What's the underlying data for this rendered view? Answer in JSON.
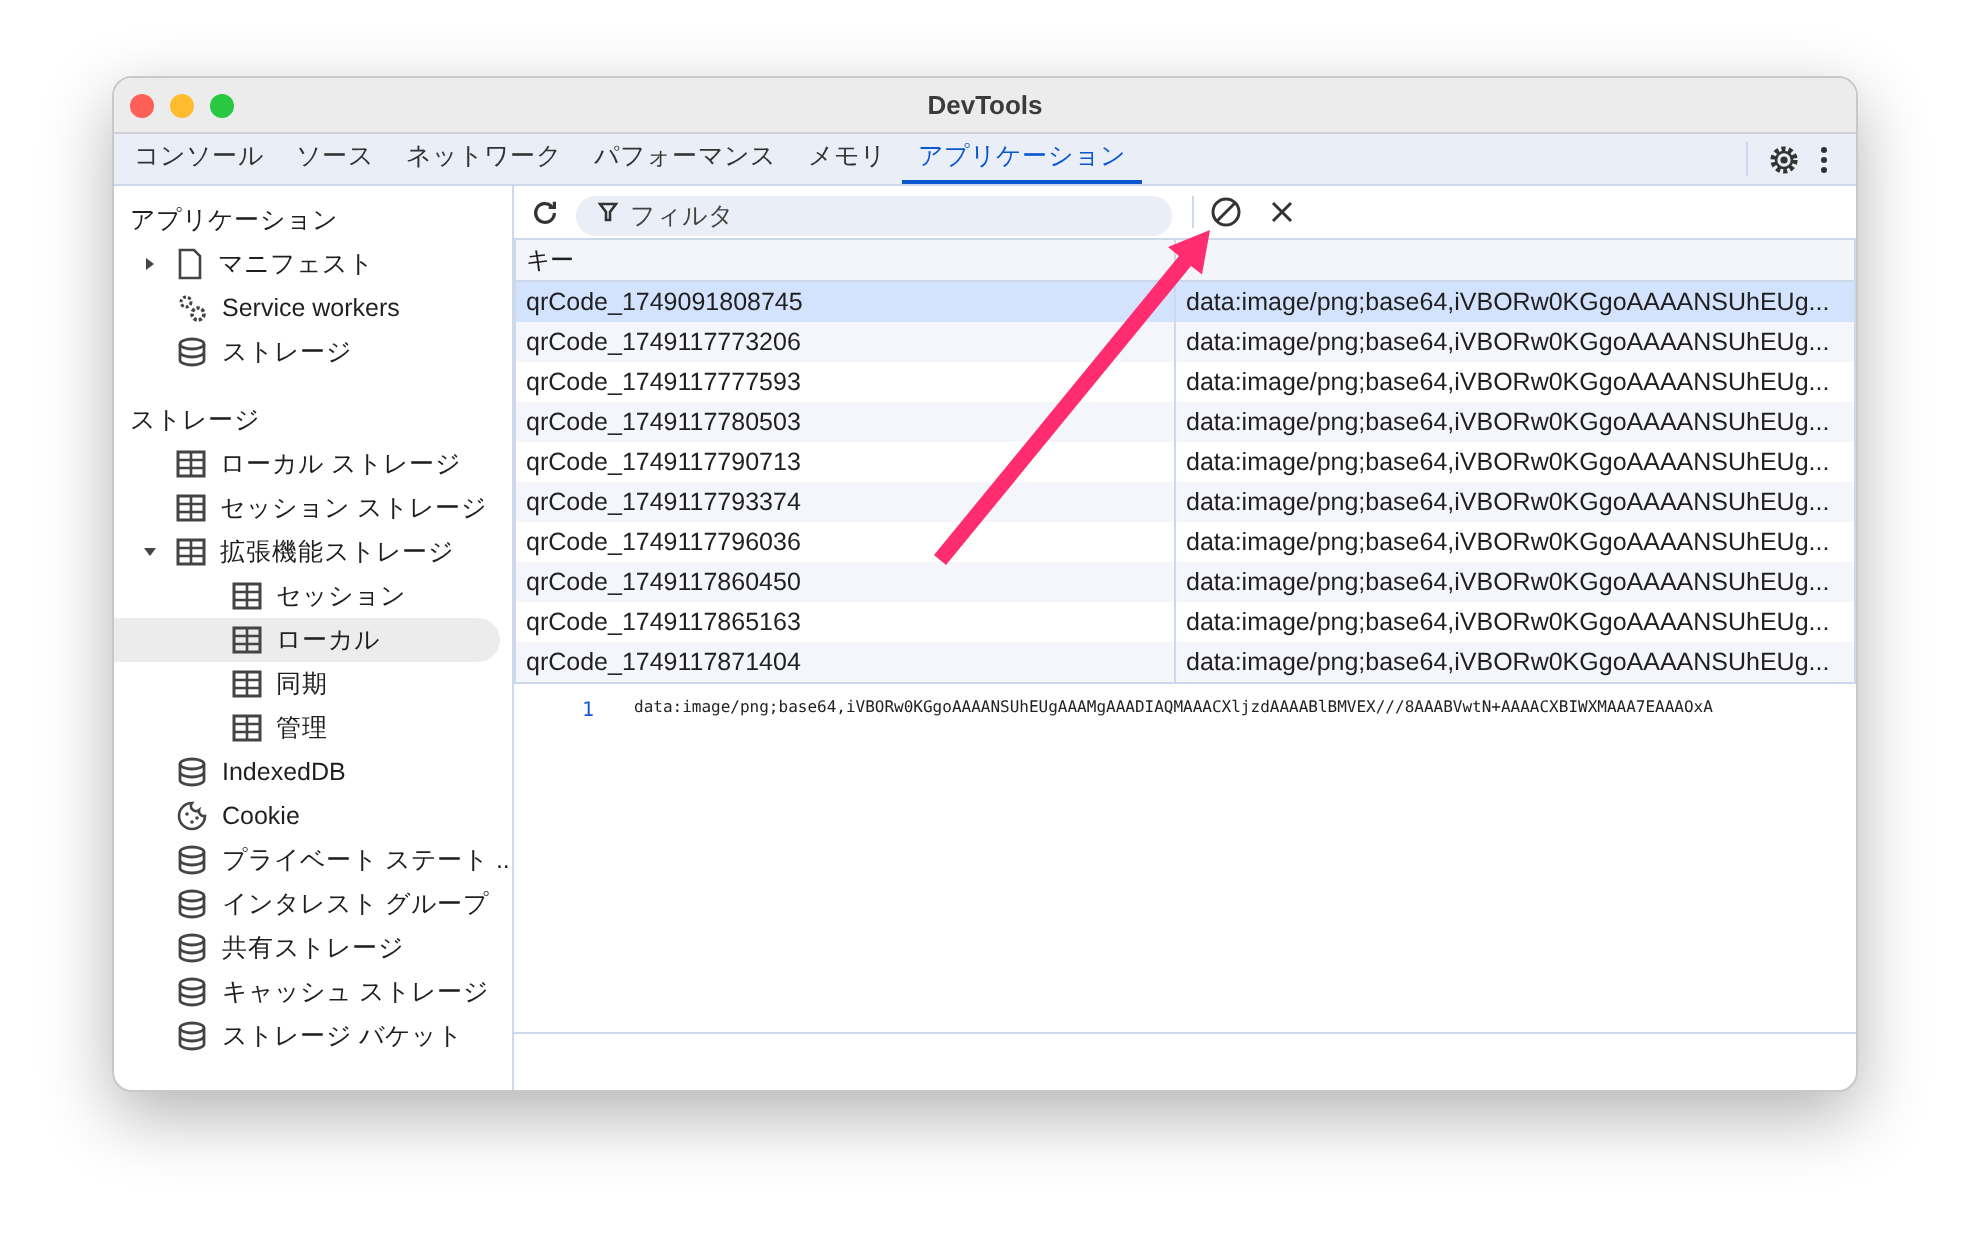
{
  "window": {
    "title": "DevTools"
  },
  "tabs": [
    {
      "label": "コンソール",
      "selected": false
    },
    {
      "label": "ソース",
      "selected": false
    },
    {
      "label": "ネットワーク",
      "selected": false
    },
    {
      "label": "パフォーマンス",
      "selected": false
    },
    {
      "label": "メモリ",
      "selected": false
    },
    {
      "label": "アプリケーション",
      "selected": true
    }
  ],
  "sidebar": {
    "sections": [
      {
        "title": "アプリケーション",
        "items": [
          {
            "label": "マニフェスト",
            "kind": "file",
            "expanded": false,
            "selected": false
          },
          {
            "label": "Service workers",
            "kind": "gears",
            "selected": false
          },
          {
            "label": "ストレージ",
            "kind": "database",
            "selected": false
          }
        ]
      },
      {
        "title": "ストレージ",
        "items": [
          {
            "label": "ローカル ストレージ",
            "kind": "table",
            "selected": false
          },
          {
            "label": "セッション ストレージ",
            "kind": "table",
            "selected": false
          },
          {
            "label": "拡張機能ストレージ",
            "kind": "table",
            "expanded": true,
            "selected": false,
            "children": [
              {
                "label": "セッション",
                "kind": "table",
                "selected": false
              },
              {
                "label": "ローカル",
                "kind": "table",
                "selected": true
              },
              {
                "label": "同期",
                "kind": "table",
                "selected": false
              },
              {
                "label": "管理",
                "kind": "table",
                "selected": false
              }
            ]
          },
          {
            "label": "IndexedDB",
            "kind": "database",
            "selected": false
          },
          {
            "label": "Cookie",
            "kind": "cookie",
            "selected": false
          },
          {
            "label": "プライベート ステート ...",
            "kind": "database",
            "selected": false
          },
          {
            "label": "インタレスト グループ",
            "kind": "database",
            "selected": false
          },
          {
            "label": "共有ストレージ",
            "kind": "database",
            "selected": false
          },
          {
            "label": "キャッシュ ストレージ",
            "kind": "database",
            "selected": false
          },
          {
            "label": "ストレージ バケット",
            "kind": "database",
            "selected": false
          }
        ]
      }
    ]
  },
  "toolbar": {
    "filter": {
      "placeholder": "フィルタ"
    }
  },
  "table": {
    "columns": [
      "キー"
    ],
    "rows": [
      {
        "key": "qrCode_1749091808745",
        "value": "data:image/png;base64,iVBORw0KGgoAAAANSUhEUg...",
        "selected": true
      },
      {
        "key": "qrCode_1749117773206",
        "value": "data:image/png;base64,iVBORw0KGgoAAAANSUhEUg...",
        "selected": false
      },
      {
        "key": "qrCode_1749117777593",
        "value": "data:image/png;base64,iVBORw0KGgoAAAANSUhEUg...",
        "selected": false
      },
      {
        "key": "qrCode_1749117780503",
        "value": "data:image/png;base64,iVBORw0KGgoAAAANSUhEUg...",
        "selected": false
      },
      {
        "key": "qrCode_1749117790713",
        "value": "data:image/png;base64,iVBORw0KGgoAAAANSUhEUg...",
        "selected": false
      },
      {
        "key": "qrCode_1749117793374",
        "value": "data:image/png;base64,iVBORw0KGgoAAAANSUhEUg...",
        "selected": false
      },
      {
        "key": "qrCode_1749117796036",
        "value": "data:image/png;base64,iVBORw0KGgoAAAANSUhEUg...",
        "selected": false
      },
      {
        "key": "qrCode_1749117860450",
        "value": "data:image/png;base64,iVBORw0KGgoAAAANSUhEUg...",
        "selected": false
      },
      {
        "key": "qrCode_1749117865163",
        "value": "data:image/png;base64,iVBORw0KGgoAAAANSUhEUg...",
        "selected": false
      },
      {
        "key": "qrCode_1749117871404",
        "value": "data:image/png;base64,iVBORw0KGgoAAAANSUhEUg...",
        "selected": false
      }
    ]
  },
  "preview": {
    "line_number": "1",
    "text": "data:image/png;base64,iVBORw0KGgoAAAANSUhEUgAAAMgAAADIAQMAAACXljzdAAAABlBMVEX///8AAABVwtN+AAAACXBIWXMAAA7EAAAOxA"
  }
}
